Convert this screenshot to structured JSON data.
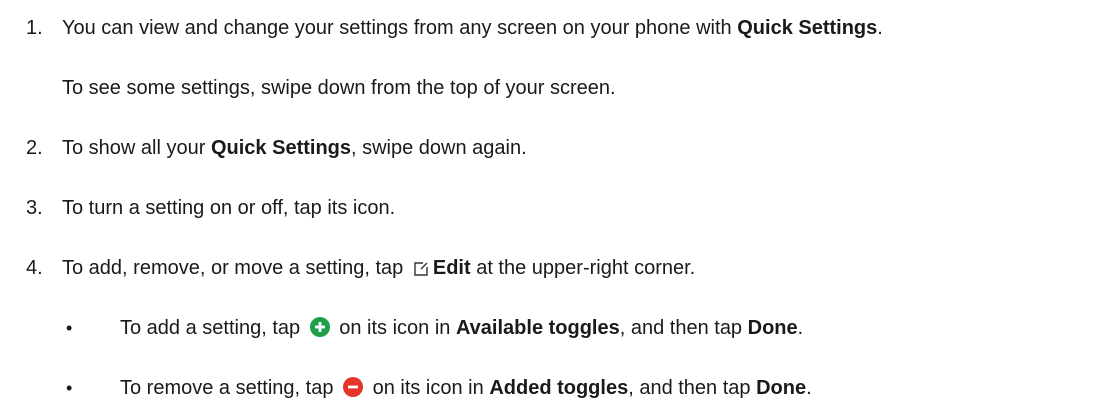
{
  "steps": [
    {
      "number": "1.",
      "pre": "You can view and change your settings from any screen on your phone with ",
      "bold": "Quick Settings",
      "post": ".",
      "sub": "To see some settings, swipe down from the top of your screen."
    },
    {
      "number": "2.",
      "pre": "To show all your ",
      "bold": "Quick Settings",
      "post": ", swipe down again."
    },
    {
      "number": "3.",
      "text": "To turn a setting on or off, tap its icon."
    },
    {
      "number": "4.",
      "pre": "To add, remove, or move a setting, tap ",
      "icon": "edit-icon",
      "bold": "Edit",
      "post": " at the upper-right corner."
    }
  ],
  "bullets": [
    {
      "symbol": "•",
      "pre": "To add a setting, tap ",
      "icon": "add-circle-icon",
      "icon_color": "#1e9e45",
      "mid": " on its icon in ",
      "bold1": "Available toggles",
      "mid2": ", and then tap ",
      "bold2": "Done",
      "post": "."
    },
    {
      "symbol": "•",
      "pre": "To remove a setting, tap ",
      "icon": "remove-circle-icon",
      "icon_color": "#e5352b",
      "mid": " on its icon in ",
      "bold1": "Added toggles",
      "mid2": ", and then tap ",
      "bold2": "Done",
      "post": "."
    }
  ]
}
